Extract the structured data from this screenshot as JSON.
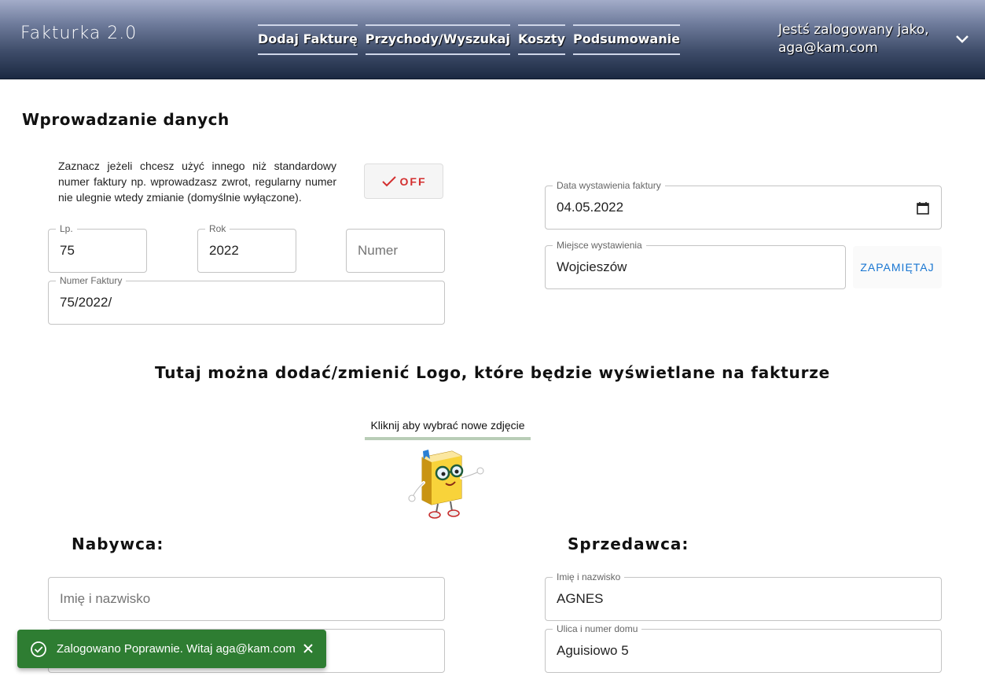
{
  "app": {
    "title": "Fakturka 2.0"
  },
  "nav": {
    "items": [
      {
        "label": "Dodaj Fakturę"
      },
      {
        "label": "Przychody/Wyszukaj"
      },
      {
        "label": "Koszty"
      },
      {
        "label": "Podsumowanie"
      }
    ]
  },
  "user": {
    "line1": "Jestś zalogowany jako,",
    "email": "aga@kam.com"
  },
  "form": {
    "title": "Wprowadzanie danych",
    "note": "Zaznacz jeżeli chcesz użyć innego niż standardowy numer faktury np. wprowadzasz zwrot, regularny numer nie ulegnie wtedy zmianie (domyślnie wyłączone).",
    "toggle_label": "OFF",
    "lp": {
      "label": "Lp.",
      "value": "75"
    },
    "rok": {
      "label": "Rok",
      "value": "2022"
    },
    "numer": {
      "placeholder": "Numer"
    },
    "numer_faktury": {
      "label": "Numer Faktury",
      "value": "75/2022/"
    },
    "data": {
      "label": "Data wystawienia faktury",
      "value": "04.05.2022"
    },
    "miejsce": {
      "label": "Miejsce wystawienia",
      "value": "Wojcieszów"
    },
    "save_button": "ZAPAMIĘTAJ"
  },
  "logo_section": {
    "title": "Tutaj można dodać/zmienić Logo, które będzie wyświetlane na fakturze",
    "pick_label": "Kliknij aby wybrać nowe zdjęcie"
  },
  "buyer": {
    "title": "Nabywca:",
    "name": {
      "placeholder": "Imię i nazwisko"
    }
  },
  "seller": {
    "title": "Sprzedawca:",
    "name": {
      "label": "Imię i nazwisko",
      "value": "AGNES"
    },
    "street": {
      "label": "Ulica i numer domu",
      "value": "Aguisiowo 5"
    }
  },
  "snackbar": {
    "message": "Zalogowano Poprawnie. Witaj aga@kam.com"
  },
  "colors": {
    "toggle_off": "#d32f2f",
    "button_text": "#1976d2",
    "snackbar_bg": "#2e7d32"
  }
}
